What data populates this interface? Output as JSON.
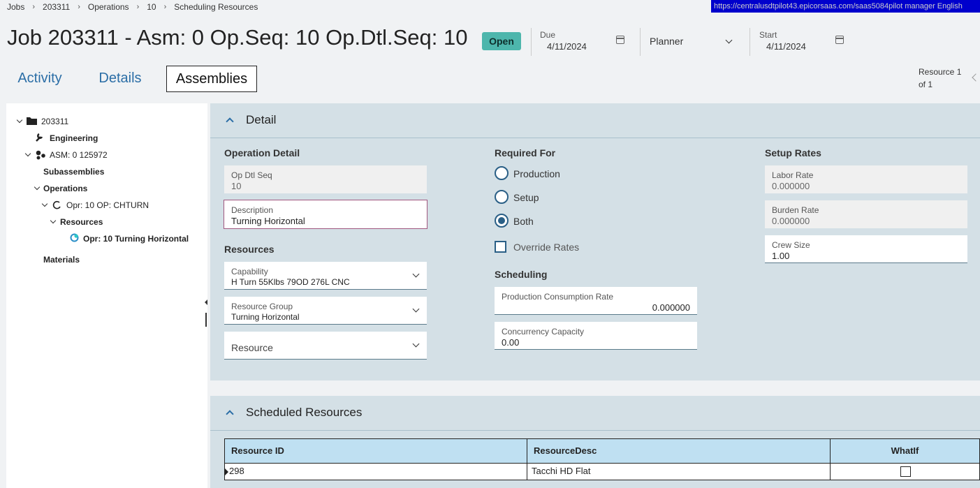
{
  "url_bar": "https://centralusdtpilot43.epicorsaas.com/saas5084pilot   manager   English",
  "breadcrumb": [
    "Jobs",
    "203311",
    "Operations",
    "10",
    "Scheduling Resources"
  ],
  "header": {
    "title": "Job 203311 - Asm: 0 Op.Seq: 10 Op.Dtl.Seq: 10",
    "status": "Open",
    "due_label": "Due",
    "due_value": "4/11/2024",
    "planner_placeholder": "Planner",
    "start_label": "Start",
    "start_value": "4/11/2024"
  },
  "tabs": [
    "Activity",
    "Details",
    "Assemblies"
  ],
  "active_tab": "Assemblies",
  "pager": {
    "line1": "Resource 1",
    "line2": "of 1"
  },
  "tree": {
    "root": "203311",
    "engineering": "Engineering",
    "asm": "ASM: 0 125972",
    "subassemblies": "Subassemblies",
    "operations": "Operations",
    "operation": "Opr: 10 OP: CHTURN",
    "resources": "Resources",
    "resource": "Opr: 10 Turning Horizontal",
    "materials": "Materials"
  },
  "detail": {
    "title": "Detail",
    "operation_detail": {
      "heading": "Operation Detail",
      "op_dtl_seq_label": "Op Dtl Seq",
      "op_dtl_seq_value": "10",
      "description_label": "Description",
      "description_value": "Turning Horizontal"
    },
    "resources": {
      "heading": "Resources",
      "capability_label": "Capability",
      "capability_value": "H Turn 55Klbs 79OD 276L CNC",
      "group_label": "Resource Group",
      "group_value": "Turning Horizontal",
      "resource_label": "Resource"
    },
    "required_for": {
      "heading": "Required For",
      "options": [
        "Production",
        "Setup",
        "Both"
      ],
      "selected": "Both",
      "override_label": "Override Rates",
      "override_checked": false
    },
    "scheduling": {
      "heading": "Scheduling",
      "prod_rate_label": "Production Consumption Rate",
      "prod_rate_value": "0.000000",
      "concurrency_label": "Concurrency Capacity",
      "concurrency_value": "0.00"
    },
    "setup_rates": {
      "heading": "Setup Rates",
      "labor_label": "Labor Rate",
      "labor_value": "0.000000",
      "burden_label": "Burden Rate",
      "burden_value": "0.000000",
      "crew_label": "Crew Size",
      "crew_value": "1.00"
    }
  },
  "scheduled": {
    "title": "Scheduled Resources",
    "columns": [
      "Resource ID",
      "ResourceDesc",
      "WhatIf"
    ],
    "rows": [
      {
        "id": "298",
        "desc": "Tacchi HD Flat",
        "whatif": false
      }
    ]
  },
  "colors": {
    "accent": "#2b6ea6",
    "badge": "#4db6ac",
    "panel": "#d4e0e6",
    "grid_header": "#bfe0f2"
  }
}
